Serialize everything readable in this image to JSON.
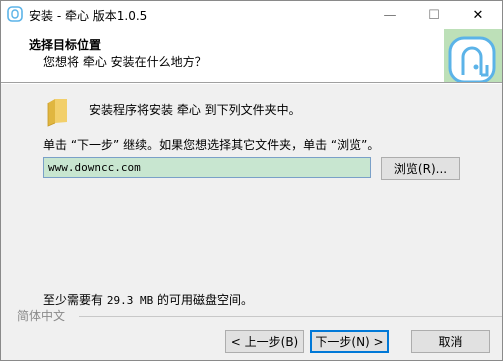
{
  "window": {
    "title": "安装 - 牵心 版本1.0.5",
    "controls": {
      "minimize": "—",
      "maximize": "☐",
      "close": "✕"
    }
  },
  "header": {
    "title": "选择目标位置",
    "subtitle": "您想将   牵心 安装在什么地方？",
    "accent_color": "#bde0b8",
    "logo_color": "#5bb3e8"
  },
  "body": {
    "install_to_text": "安装程序将安装   牵心 到下列文件夹中。",
    "instruction": "单击 “下一步” 继续。如果您想选择其它文件夹，单击 “浏览”。",
    "path_value": "www.downcc.com",
    "browse_label": "浏览(R)...",
    "space_prefix": "至少需要有",
    "space_value": "29.3 MB",
    "space_suffix": "的可用磁盘空间。"
  },
  "footer": {
    "language": "简体中文",
    "back_label": "< 上一步(B)",
    "next_label": "下一步(N) >",
    "cancel_label": "取消"
  }
}
